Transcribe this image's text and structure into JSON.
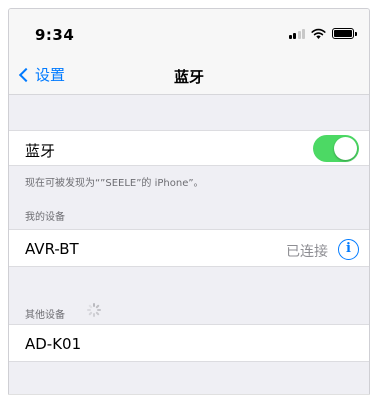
{
  "status_bar": {
    "time": "9:34"
  },
  "nav": {
    "back_label": "设置",
    "title": "蓝牙"
  },
  "bluetooth": {
    "label": "蓝牙",
    "enabled": true,
    "accent": "#4cd964"
  },
  "discoverable_note": "现在可被发现为“”SEELE”的 iPhone”。",
  "my_devices": {
    "header": "我的设备",
    "items": [
      {
        "name": "AVR-BT",
        "status": "已连接",
        "info_icon": "i"
      }
    ]
  },
  "other_devices": {
    "header": "其他设备",
    "items": [
      {
        "name": "AD-K01"
      }
    ]
  },
  "colors": {
    "link": "#007aff",
    "background": "#efeff4"
  }
}
